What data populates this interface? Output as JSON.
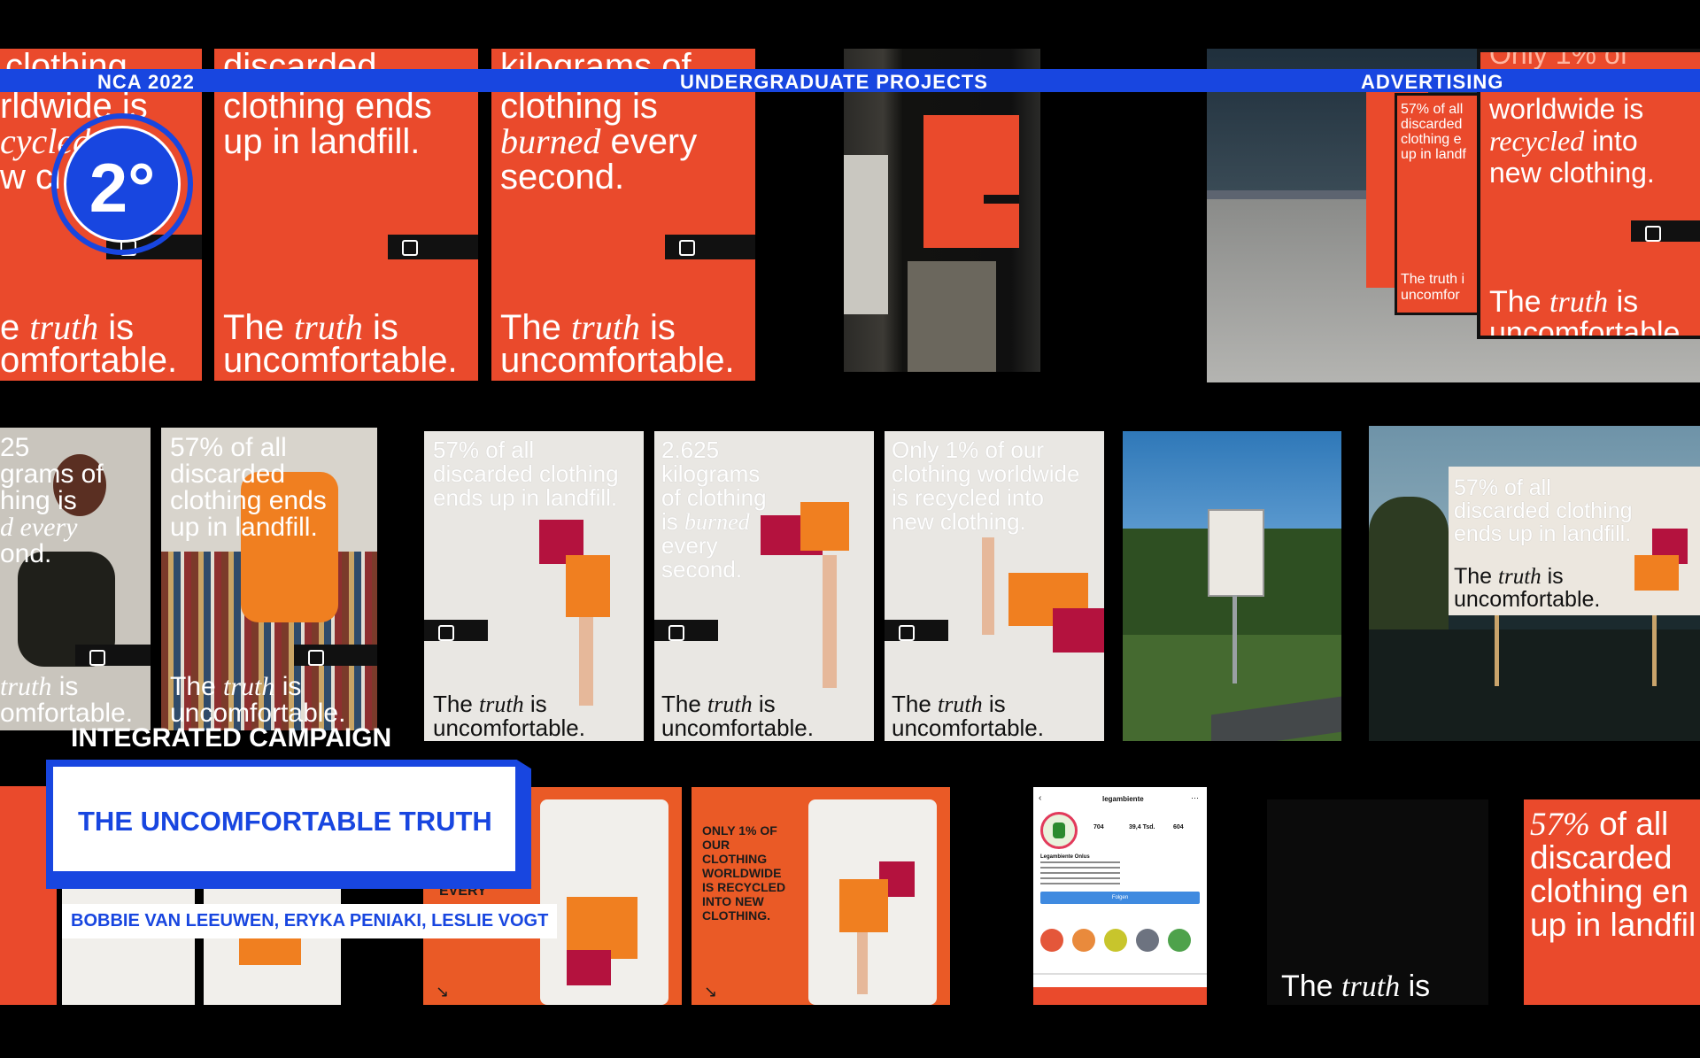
{
  "header": {
    "left": "NCA 2022",
    "center": "UNDERGRADUATE PROJECTS",
    "right": "ADVERTISING"
  },
  "badge": {
    "label": "2°"
  },
  "caption": {
    "category": "INTEGRATED CAMPAIGN",
    "title": "THE UNCOMFORTABLE TRUTH",
    "authors": "BOBBIE VAN LEEUWEN, ERYKA PENIAKI, LESLIE VOGT"
  },
  "posters": {
    "p1_top1": "clothing",
    "p1_top2": "rldwide is",
    "p1_top3": "cycled into",
    "p1_top4": "w cl",
    "p2_top1": "discarded",
    "p2_top2": "clothing ends",
    "p2_top3": "up in landfill.",
    "p3_top1": "kilograms of",
    "p3_top2": "clothing is",
    "p3_burned": "burned",
    "p3_every": " every",
    "p3_top4": "second.",
    "tag_the": "The ",
    "tag_truth": "truth",
    "tag_is": " is",
    "tag_unc": "uncomfortable.",
    "p1_tag_the": "e ",
    "p1_tag_unc": "omfortable.",
    "right_top1": "Only 1% of",
    "right_top2": "worldwide is",
    "right_recycled": "recycled",
    "right_into": " into",
    "right_top4": "new clothing.",
    "mini1": "57% of all",
    "mini2": "discarded",
    "mini3": "clothing e",
    "mini4": "up in landf",
    "mini_tag": "The truth i",
    "mini_unc": "uncomfor",
    "row2_a1": "25",
    "row2_a2": "grams of",
    "row2_a3": "hing is",
    "row2_a4": "d every",
    "row2_a5": "ond.",
    "row2_b1": "57% of all",
    "row2_b2": "discarded",
    "row2_b3": "clothing ends",
    "row2_b4": "up in landfill.",
    "row2_c1": "57% of all",
    "row2_c2": "discarded clothing",
    "row2_c3": "ends up in landfill.",
    "row2_d1": "2.625",
    "row2_d2": "kilograms",
    "row2_d3": "of clothing",
    "row2_d4": "is",
    "row2_d_burned": "burned",
    "row2_d5": "every",
    "row2_d6": "second.",
    "row2_e1": "Only 1% of our",
    "row2_e2": "clothing worldwide",
    "row2_e3": "is recycled into",
    "row2_e4": "new clothing.",
    "bb1": "57% of all",
    "bb2": "discarded clothing",
    "bb3": "ends up in landfill.",
    "row3_orange1": "ONLY 1% OF",
    "row3_orange2": "OUR",
    "row3_orange3": "CLOTHING",
    "row3_orange4": "WORLDWIDE",
    "row3_orange5": "IS RECYCLED",
    "row3_orange6": "INTO NEW",
    "row3_orange7": "CLOTHING.",
    "row3_every": "EVERY",
    "row3_red1_pct": "57%",
    "row3_red1": " of all",
    "row3_red2": "discarded",
    "row3_red3": "clothing en",
    "row3_red4": "up in landfil",
    "phone_name": "legambiente",
    "phone_stats": [
      "704",
      "39,4 Tsd.",
      "604"
    ],
    "phone_bio": "Legambiente Onlus",
    "phone_button": "Folgen"
  }
}
